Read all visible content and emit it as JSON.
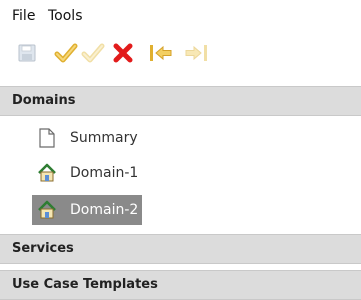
{
  "menubar": {
    "items": [
      {
        "label": "File"
      },
      {
        "label": "Tools"
      }
    ]
  },
  "toolbar": {
    "buttons": [
      {
        "icon": "save-icon",
        "enabled": false
      },
      {
        "icon": "check-icon",
        "enabled": true
      },
      {
        "icon": "check-icon",
        "enabled": false
      },
      {
        "icon": "delete-icon",
        "enabled": true
      },
      {
        "icon": "move-left-icon",
        "enabled": true
      },
      {
        "icon": "move-right-icon",
        "enabled": false
      }
    ]
  },
  "sections": {
    "domains": {
      "label": "Domains"
    },
    "services": {
      "label": "Services"
    },
    "templates": {
      "label": "Use Case Templates"
    }
  },
  "tree": {
    "items": [
      {
        "label": "Summary",
        "icon": "document-icon"
      },
      {
        "label": "Domain-1",
        "icon": "house-icon"
      },
      {
        "label": "Domain-2",
        "icon": "house-icon",
        "selected": true
      }
    ]
  },
  "colors": {
    "header_bg": "#dcdcdc",
    "selected_bg": "#8a8a8a",
    "delete_red": "#e21b1b",
    "arrow_gold": "#e0b030"
  }
}
